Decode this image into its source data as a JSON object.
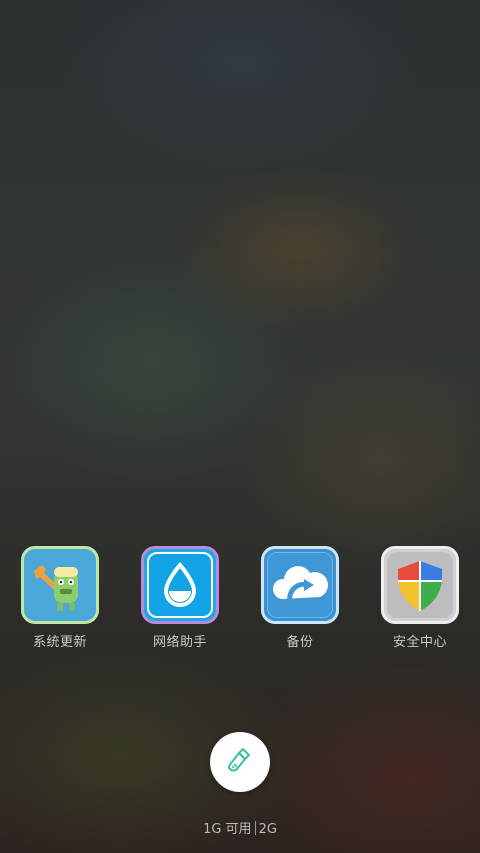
{
  "apps": [
    {
      "label": "系统更新",
      "icon": "system-update-icon"
    },
    {
      "label": "网络助手",
      "icon": "network-assistant-icon"
    },
    {
      "label": "备份",
      "icon": "backup-cloud-icon"
    },
    {
      "label": "安全中心",
      "icon": "security-shield-icon"
    }
  ],
  "clean_button": {
    "icon": "broom-clean-icon",
    "color": "#3dbfa6"
  },
  "memory": {
    "available": "1G 可用",
    "total": "2G"
  }
}
